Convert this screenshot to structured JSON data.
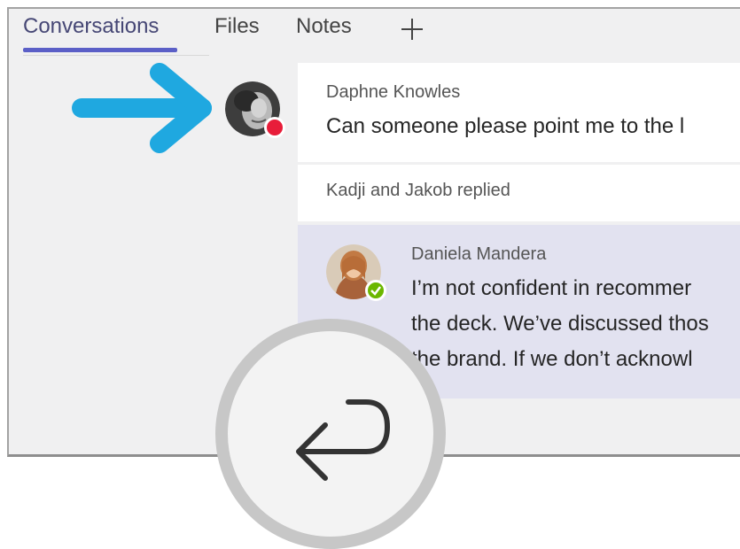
{
  "tabs": {
    "items": [
      {
        "label": "Conversations",
        "active": true
      },
      {
        "label": "Files",
        "active": false
      },
      {
        "label": "Notes",
        "active": false
      }
    ],
    "add_icon": "plus-icon"
  },
  "post": {
    "author": "Daphne Knowles",
    "message": "Can someone please point me to the l",
    "presence_color": "#e81d3a"
  },
  "replied": {
    "text": "Kadji and Jakob replied"
  },
  "reply": {
    "author": "Daniela Mandera",
    "lines": [
      "I’m not confident in recommer",
      "the deck. We’ve discussed thos",
      "the brand. If we don’t acknowl"
    ],
    "presence_color": "#6bb700"
  },
  "colors": {
    "accent": "#5b5fc7",
    "arrow": "#1fa8e0",
    "reply_bg": "#e2e2f0"
  },
  "icons": [
    "plus-icon",
    "pointer-arrow-icon",
    "reply-icon"
  ]
}
